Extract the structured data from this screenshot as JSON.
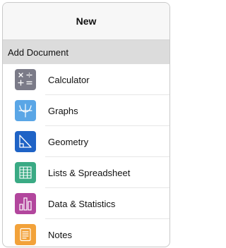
{
  "header": {
    "title": "New"
  },
  "section": {
    "title": "Add Document"
  },
  "items": [
    {
      "label": "Calculator",
      "icon": "calculator-icon",
      "color": "#7b7b88"
    },
    {
      "label": "Graphs",
      "icon": "graphs-icon",
      "color": "#5aa6e6"
    },
    {
      "label": "Geometry",
      "icon": "geometry-icon",
      "color": "#1f63c6"
    },
    {
      "label": "Lists & Spreadsheet",
      "icon": "spreadsheet-icon",
      "color": "#3aaa84"
    },
    {
      "label": "Data & Statistics",
      "icon": "data-statistics-icon",
      "color": "#b2469d"
    },
    {
      "label": "Notes",
      "icon": "notes-icon",
      "color": "#f2a23a"
    }
  ]
}
